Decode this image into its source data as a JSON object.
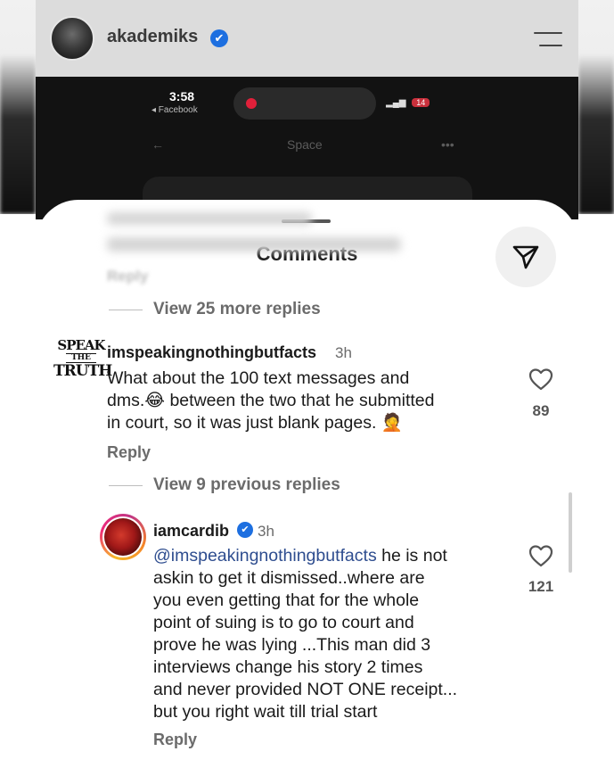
{
  "header": {
    "username": "akademiks",
    "verified_glyph": "✔"
  },
  "inner_screenshot": {
    "time": "3:58",
    "back_app": "◂ Facebook",
    "battery": "14",
    "page_title": "Space",
    "back_arrow": "←",
    "more": "•••"
  },
  "sheet": {
    "title": "Comments",
    "blurred_reply": "Reply",
    "view_more_replies": "View 25 more replies",
    "view_previous_replies": "View 9 previous replies"
  },
  "comments": [
    {
      "username": "imspeakingnothingbutfacts",
      "time": "3h",
      "avatar_logo": {
        "l1": "SPEAK",
        "l2": "THE",
        "l3": "TRUTH"
      },
      "lines": [
        "What about the 100 text messages and",
        "dms.😂 between the two that he submitted",
        "in court, so it was just blank pages. 🤦"
      ],
      "likes": "89",
      "reply_label": "Reply"
    },
    {
      "username": "iamcardib",
      "time": "3h",
      "mention": "@imspeakingnothingbutfacts",
      "first_line_rest": " he is not",
      "lines": [
        "askin to get it dismissed..where are",
        "you even getting that for the whole",
        "point of suing is to go to court and",
        "prove he was lying ...This man did 3",
        "interviews change his story 2 times",
        "and never provided NOT ONE receipt...",
        "but you right wait till trial start"
      ],
      "likes": "121",
      "reply_label": "Reply"
    }
  ],
  "icons": {
    "menu": "hamburger-menu-icon",
    "share": "send-icon",
    "like": "heart-outline-icon",
    "verified": "verified-badge-icon"
  },
  "colors": {
    "verified_blue": "#1d6fe0",
    "mention_blue": "#2e4d8f",
    "muted_text": "#6b6b6b"
  }
}
